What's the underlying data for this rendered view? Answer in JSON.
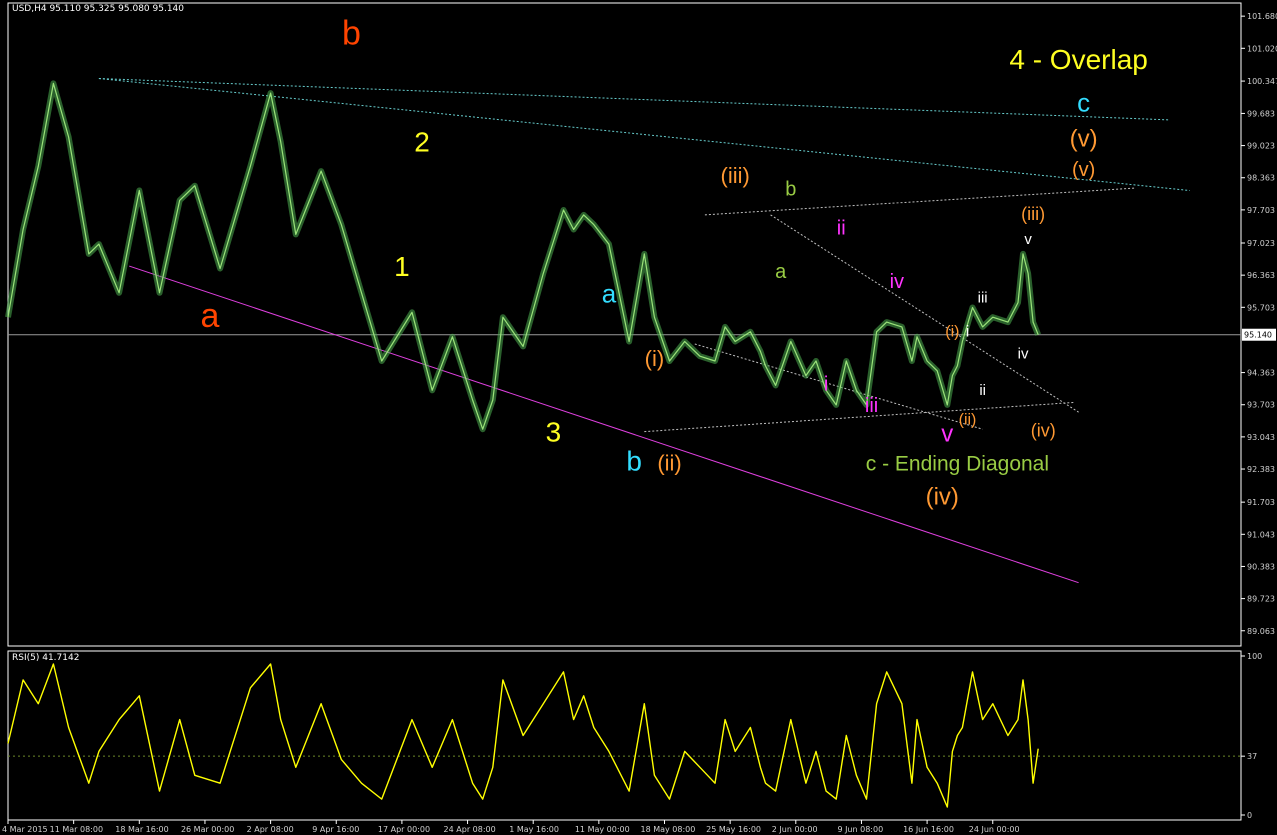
{
  "chart_data": {
    "type": "line",
    "title": "USD,H4  95.110 95.325 95.080 95.140",
    "price_axis": {
      "ylim": [
        88.75,
        101.95
      ],
      "ticks": [
        "101.680",
        "101.020",
        "100.347",
        "99.683",
        "99.023",
        "98.363",
        "97.703",
        "97.023",
        "96.363",
        "95.703",
        "94.363",
        "93.703",
        "93.043",
        "92.383",
        "91.703",
        "91.043",
        "90.383",
        "89.723",
        "89.063"
      ],
      "tick_values": [
        101.68,
        101.02,
        100.347,
        99.683,
        99.023,
        98.363,
        97.703,
        97.023,
        96.363,
        95.703,
        94.363,
        93.703,
        93.043,
        92.383,
        91.703,
        91.043,
        90.383,
        89.723,
        89.063
      ],
      "current_price": "95.140",
      "current_value": 95.14
    },
    "time_axis": {
      "labels": [
        "4 Mar 2015",
        "11 Mar 08:00",
        "18 Mar 16:00",
        "26 Mar 00:00",
        "2 Apr 08:00",
        "9 Apr 16:00",
        "17 Apr 00:00",
        "24 Apr 08:00",
        "1 May 16:00",
        "11 May 00:00",
        "18 May 08:00",
        "25 May 16:00",
        "2 Jun 00:00",
        "9 Jun 08:00",
        "16 Jun 16:00",
        "24 Jun 00:00"
      ],
      "positions": [
        0,
        13,
        26,
        39,
        52,
        65,
        78,
        91,
        104,
        117,
        130,
        143,
        156,
        169,
        182,
        195
      ]
    },
    "price_series": {
      "name": "USD",
      "x": [
        0,
        3,
        6,
        9,
        12,
        16,
        18,
        22,
        26,
        30,
        34,
        37,
        42,
        48,
        52,
        54,
        57,
        62,
        66,
        70,
        74,
        80,
        84,
        88,
        92,
        94,
        96,
        98,
        102,
        106,
        110,
        112,
        114,
        116,
        119,
        123,
        126,
        128,
        131,
        134,
        137,
        140,
        142,
        144,
        147,
        149,
        150,
        152,
        155,
        158,
        160,
        162,
        164,
        166,
        168,
        170,
        172,
        174,
        177,
        179,
        180,
        182,
        184,
        186,
        187,
        188,
        189,
        191,
        193,
        195,
        198,
        200,
        201,
        202,
        203,
        204
      ],
      "y": [
        95.5,
        97.3,
        98.6,
        100.3,
        99.2,
        96.8,
        97.0,
        96.0,
        98.1,
        96.0,
        97.9,
        98.2,
        96.5,
        98.6,
        100.1,
        99.1,
        97.2,
        98.5,
        97.4,
        96.0,
        94.6,
        95.6,
        94.0,
        95.1,
        93.8,
        93.2,
        93.8,
        95.5,
        94.9,
        96.4,
        97.7,
        97.3,
        97.6,
        97.4,
        97.0,
        95.0,
        96.8,
        95.5,
        94.6,
        95.0,
        94.7,
        94.6,
        95.3,
        95.0,
        95.2,
        94.8,
        94.5,
        94.1,
        95.0,
        94.3,
        94.6,
        94.0,
        93.7,
        94.6,
        94.0,
        93.7,
        95.2,
        95.4,
        95.3,
        94.6,
        95.1,
        94.6,
        94.4,
        93.7,
        94.3,
        94.5,
        95.0,
        95.7,
        95.3,
        95.5,
        95.4,
        95.8,
        96.8,
        96.4,
        95.4,
        95.14
      ]
    },
    "rsi": {
      "name": "RSI(5)",
      "label": "RSI(5) 41.7142",
      "ylim": [
        0,
        100
      ],
      "ticks": [
        "100",
        "37",
        "0"
      ],
      "tick_values": [
        100,
        37,
        0
      ],
      "level": 37,
      "x": [
        0,
        3,
        6,
        9,
        12,
        16,
        18,
        22,
        26,
        30,
        34,
        37,
        42,
        48,
        52,
        54,
        57,
        62,
        66,
        70,
        74,
        80,
        84,
        88,
        92,
        94,
        96,
        98,
        102,
        106,
        110,
        112,
        114,
        116,
        119,
        123,
        126,
        128,
        131,
        134,
        137,
        140,
        142,
        144,
        147,
        149,
        150,
        152,
        155,
        158,
        160,
        162,
        164,
        166,
        168,
        170,
        172,
        174,
        177,
        179,
        180,
        182,
        184,
        186,
        187,
        188,
        189,
        191,
        193,
        195,
        198,
        200,
        201,
        202,
        203,
        204
      ],
      "values": [
        45,
        85,
        70,
        95,
        55,
        20,
        40,
        60,
        75,
        15,
        60,
        25,
        20,
        80,
        95,
        60,
        30,
        70,
        35,
        20,
        10,
        60,
        30,
        60,
        20,
        10,
        30,
        85,
        50,
        70,
        90,
        60,
        75,
        55,
        40,
        15,
        70,
        25,
        10,
        40,
        30,
        20,
        60,
        40,
        55,
        30,
        20,
        15,
        60,
        20,
        40,
        15,
        10,
        50,
        25,
        10,
        70,
        90,
        70,
        20,
        60,
        30,
        20,
        5,
        40,
        50,
        55,
        90,
        60,
        70,
        50,
        60,
        85,
        60,
        20,
        41.7142
      ]
    },
    "trendlines": [
      {
        "style": "solid",
        "color": "#e040e0",
        "x": [
          24,
          212
        ],
        "y": [
          96.55,
          90.05
        ]
      },
      {
        "style": "dotted",
        "color": "#66cccc",
        "x": [
          18,
          230
        ],
        "y": [
          100.4,
          99.55
        ]
      },
      {
        "style": "dotted",
        "color": "#66cccc",
        "x": [
          18,
          234
        ],
        "y": [
          100.4,
          98.1
        ]
      },
      {
        "style": "dotted",
        "color": "#c0c0c0",
        "x": [
          138,
          223
        ],
        "y": [
          97.6,
          98.15
        ]
      },
      {
        "style": "dotted",
        "color": "#c0c0c0",
        "x": [
          126,
          211
        ],
        "y": [
          93.15,
          93.75
        ]
      },
      {
        "style": "dotted",
        "color": "#c0c0c0",
        "x": [
          136,
          193
        ],
        "y": [
          94.95,
          93.2
        ]
      },
      {
        "style": "dotted",
        "color": "#c0c0c0",
        "x": [
          151,
          212
        ],
        "y": [
          97.6,
          93.55
        ]
      }
    ],
    "annotations": [
      {
        "text": "a",
        "x": 40,
        "y": 95.3,
        "color": "#ff4400",
        "size": 34
      },
      {
        "text": "b",
        "x": 68,
        "y": 101.1,
        "color": "#ff4400",
        "size": 34
      },
      {
        "text": "1",
        "x": 78,
        "y": 96.35,
        "color": "#ffff22",
        "size": 28
      },
      {
        "text": "2",
        "x": 82,
        "y": 98.9,
        "color": "#ffff22",
        "size": 28
      },
      {
        "text": "3",
        "x": 108,
        "y": 92.95,
        "color": "#ffff22",
        "size": 28
      },
      {
        "text": "a",
        "x": 119,
        "y": 95.8,
        "color": "#33ddff",
        "size": 26
      },
      {
        "text": "b",
        "x": 124,
        "y": 92.35,
        "color": "#33ddff",
        "size": 28
      },
      {
        "text": "(i)",
        "x": 128,
        "y": 94.5,
        "color": "#ff9933",
        "size": 22
      },
      {
        "text": "(ii)",
        "x": 131,
        "y": 92.35,
        "color": "#ff9933",
        "size": 22
      },
      {
        "text": "(iii)",
        "x": 144,
        "y": 98.25,
        "color": "#ff9933",
        "size": 22
      },
      {
        "text": "b",
        "x": 155,
        "y": 98.0,
        "color": "#99cc44",
        "size": 20
      },
      {
        "text": "a",
        "x": 153,
        "y": 96.3,
        "color": "#99cc44",
        "size": 20
      },
      {
        "text": "ii",
        "x": 165,
        "y": 97.2,
        "color": "#ff33ff",
        "size": 20
      },
      {
        "text": "iv",
        "x": 176,
        "y": 96.1,
        "color": "#ff33ff",
        "size": 20
      },
      {
        "text": "i",
        "x": 162,
        "y": 94.0,
        "color": "#ff33ff",
        "size": 20
      },
      {
        "text": "iii",
        "x": 171,
        "y": 93.55,
        "color": "#ff33ff",
        "size": 20
      },
      {
        "text": "v",
        "x": 186,
        "y": 92.95,
        "color": "#ff33ff",
        "size": 24
      },
      {
        "text": "c - Ending Diagonal",
        "x": 188,
        "y": 92.35,
        "color": "#99cc44",
        "size": 21
      },
      {
        "text": "(iv)",
        "x": 185,
        "y": 91.65,
        "color": "#ff9933",
        "size": 24
      },
      {
        "text": "(i)",
        "x": 187,
        "y": 95.1,
        "color": "#ff9933",
        "size": 16
      },
      {
        "text": "i",
        "x": 190,
        "y": 95.1,
        "color": "#ffffff",
        "size": 16
      },
      {
        "text": "(ii)",
        "x": 190,
        "y": 93.3,
        "color": "#ff9933",
        "size": 16
      },
      {
        "text": "ii",
        "x": 193,
        "y": 93.9,
        "color": "#ffffff",
        "size": 15
      },
      {
        "text": "iii",
        "x": 193,
        "y": 95.8,
        "color": "#ffffff",
        "size": 15
      },
      {
        "text": "iv",
        "x": 201,
        "y": 94.65,
        "color": "#ffffff",
        "size": 15
      },
      {
        "text": "v",
        "x": 202,
        "y": 97.0,
        "color": "#ffffff",
        "size": 15
      },
      {
        "text": "(iii)",
        "x": 203,
        "y": 97.5,
        "color": "#ff9933",
        "size": 18
      },
      {
        "text": "(iv)",
        "x": 205,
        "y": 93.05,
        "color": "#ff9933",
        "size": 18
      },
      {
        "text": "(v)",
        "x": 213,
        "y": 98.4,
        "color": "#ff9933",
        "size": 20
      },
      {
        "text": "(v)",
        "x": 213,
        "y": 99.0,
        "color": "#ff9933",
        "size": 24
      },
      {
        "text": "c",
        "x": 213,
        "y": 99.72,
        "color": "#33ddff",
        "size": 26
      },
      {
        "text": "4 - Overlap",
        "x": 212,
        "y": 100.6,
        "color": "#ffff22",
        "size": 28
      }
    ],
    "colors": {
      "price": "#4caf50",
      "rsi": "#ffff00",
      "axis": "#ffffff",
      "background": "#000000"
    }
  }
}
